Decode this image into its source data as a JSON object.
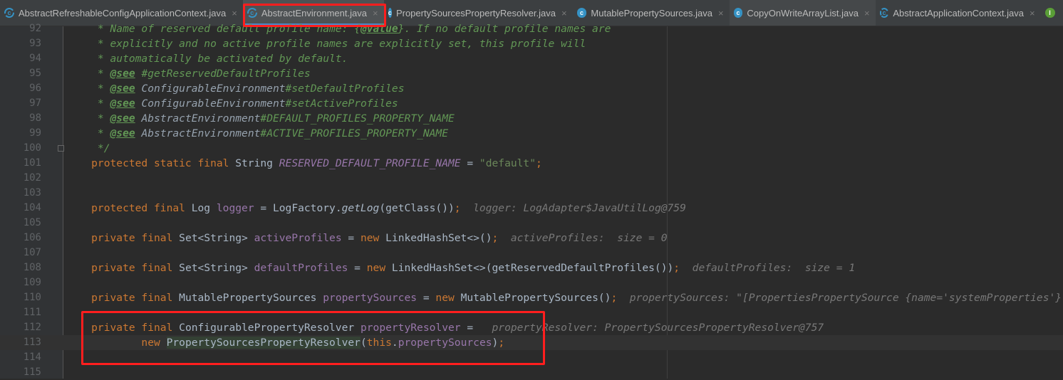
{
  "tabs": [
    {
      "label": "AbstractRefreshableConfigApplicationContext.java",
      "icon": "abstract-class-icon",
      "active": false
    },
    {
      "label": "AbstractEnvironment.java",
      "icon": "abstract-class-icon",
      "active": true
    },
    {
      "label": "PropertySourcesPropertyResolver.java",
      "icon": "class-icon",
      "active": false
    },
    {
      "label": "MutablePropertySources.java",
      "icon": "class-icon",
      "active": false
    },
    {
      "label": "CopyOnWriteArrayList.java",
      "icon": "class-icon",
      "active": false
    },
    {
      "label": "AbstractApplicationContext.java",
      "icon": "abstract-class-icon",
      "active": false
    },
    {
      "label": "",
      "icon": "interface-icon",
      "active": false
    }
  ],
  "close_glyph": "×",
  "colors": {
    "keyword": "#cc7832",
    "comment": "#629755",
    "field": "#9876aa",
    "string": "#6a8759",
    "hint": "#787878",
    "highlight": "#ff1e1e",
    "background": "#2b2b2b"
  },
  "lines": [
    {
      "n": "92",
      "seg": [
        [
          "c",
          "     * Name of reserved default profile name: {"
        ],
        [
          "t",
          "@value"
        ],
        [
          "c",
          "}. If no default profile names are"
        ]
      ]
    },
    {
      "n": "93",
      "seg": [
        [
          "c",
          "     * explicitly and no active profile names are explicitly set, this profile will"
        ]
      ]
    },
    {
      "n": "94",
      "seg": [
        [
          "c",
          "     * automatically be activated by default."
        ]
      ]
    },
    {
      "n": "95",
      "seg": [
        [
          "c",
          "     * "
        ],
        [
          "t",
          "@see"
        ],
        [
          "c",
          " #getReservedDefaultProfiles"
        ]
      ]
    },
    {
      "n": "96",
      "seg": [
        [
          "c",
          "     * "
        ],
        [
          "t",
          "@see"
        ],
        [
          "r",
          " ConfigurableEnvironment"
        ],
        [
          "c",
          "#setDefaultProfiles"
        ]
      ]
    },
    {
      "n": "97",
      "seg": [
        [
          "c",
          "     * "
        ],
        [
          "t",
          "@see"
        ],
        [
          "r",
          " ConfigurableEnvironment"
        ],
        [
          "c",
          "#setActiveProfiles"
        ]
      ]
    },
    {
      "n": "98",
      "seg": [
        [
          "c",
          "     * "
        ],
        [
          "t",
          "@see"
        ],
        [
          "r",
          " AbstractEnvironment"
        ],
        [
          "c",
          "#DEFAULT_PROFILES_PROPERTY_NAME"
        ]
      ]
    },
    {
      "n": "99",
      "seg": [
        [
          "c",
          "     * "
        ],
        [
          "t",
          "@see"
        ],
        [
          "r",
          " AbstractEnvironment"
        ],
        [
          "c",
          "#ACTIVE_PROFILES_PROPERTY_NAME"
        ]
      ]
    },
    {
      "n": "100",
      "seg": [
        [
          "c",
          "     */"
        ]
      ]
    },
    {
      "n": "101",
      "seg": [
        [
          "k",
          "    protected static final "
        ],
        [
          "p",
          "String "
        ],
        [
          "m",
          "RESERVED_DEFAULT_PROFILE_NAME"
        ],
        [
          "p",
          " = "
        ],
        [
          "s",
          "\"default\""
        ],
        [
          "k",
          ";"
        ]
      ]
    },
    {
      "n": "102",
      "seg": []
    },
    {
      "n": "103",
      "seg": []
    },
    {
      "n": "104",
      "seg": [
        [
          "k",
          "    protected final "
        ],
        [
          "p",
          "Log "
        ],
        [
          "f",
          "logger"
        ],
        [
          "p",
          " = LogFactory."
        ],
        [
          "i",
          "getLog"
        ],
        [
          "p",
          "(getClass())"
        ],
        [
          "k",
          ";"
        ],
        [
          "h",
          "  logger: LogAdapter$JavaUtilLog@759"
        ]
      ]
    },
    {
      "n": "105",
      "seg": []
    },
    {
      "n": "106",
      "seg": [
        [
          "k",
          "    private final "
        ],
        [
          "p",
          "Set<String> "
        ],
        [
          "f",
          "activeProfiles"
        ],
        [
          "p",
          " = "
        ],
        [
          "k",
          "new "
        ],
        [
          "p",
          "LinkedHashSet<>()"
        ],
        [
          "k",
          ";"
        ],
        [
          "h",
          "  activeProfiles:  size = 0"
        ]
      ]
    },
    {
      "n": "107",
      "seg": []
    },
    {
      "n": "108",
      "seg": [
        [
          "k",
          "    private final "
        ],
        [
          "p",
          "Set<String> "
        ],
        [
          "f",
          "defaultProfiles"
        ],
        [
          "p",
          " = "
        ],
        [
          "k",
          "new "
        ],
        [
          "p",
          "LinkedHashSet<>(getReservedDefaultProfiles())"
        ],
        [
          "k",
          ";"
        ],
        [
          "h",
          "  defaultProfiles:  size = 1"
        ]
      ]
    },
    {
      "n": "109",
      "seg": []
    },
    {
      "n": "110",
      "seg": [
        [
          "k",
          "    private final "
        ],
        [
          "p",
          "MutablePropertySources "
        ],
        [
          "f",
          "propertySources"
        ],
        [
          "p",
          " = "
        ],
        [
          "k",
          "new "
        ],
        [
          "p",
          "MutablePropertySources()"
        ],
        [
          "k",
          ";"
        ],
        [
          "h",
          "  propertySources: \"[PropertiesPropertySource {name='systemProperties'}"
        ]
      ]
    },
    {
      "n": "111",
      "seg": []
    },
    {
      "n": "112",
      "seg": [
        [
          "k",
          "    private final "
        ],
        [
          "p",
          "ConfigurablePropertyResolver "
        ],
        [
          "f",
          "propertyResolver"
        ],
        [
          "p",
          " = "
        ],
        [
          "h",
          "  propertyResolver: PropertySourcesPropertyResolver@757"
        ]
      ]
    },
    {
      "n": "113",
      "cur": true,
      "seg": [
        [
          "k",
          "            new "
        ],
        [
          "g",
          "PropertySourcesPropertyResolver"
        ],
        [
          "p",
          "("
        ],
        [
          "k",
          "this"
        ],
        [
          "p",
          "."
        ],
        [
          "f",
          "propertySources"
        ],
        [
          "p",
          ")"
        ],
        [
          "k",
          ";"
        ]
      ]
    },
    {
      "n": "114",
      "seg": []
    },
    {
      "n": "115",
      "seg": []
    }
  ]
}
